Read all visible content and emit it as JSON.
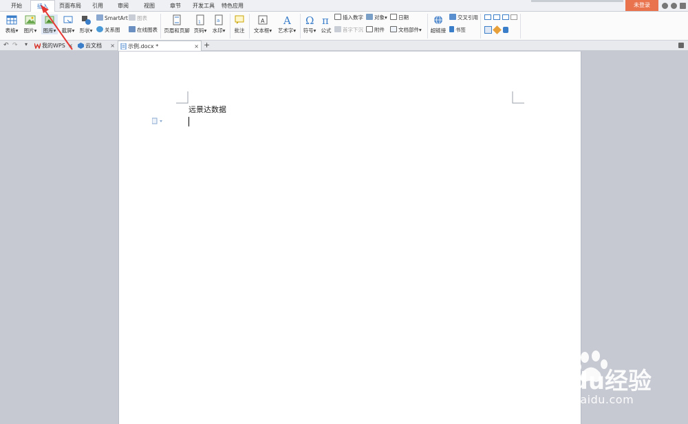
{
  "menu": {
    "tabs": [
      {
        "label": "开始"
      },
      {
        "label": "插入"
      },
      {
        "label": "页面布局"
      },
      {
        "label": "引用"
      },
      {
        "label": "审阅"
      },
      {
        "label": "视图"
      },
      {
        "label": "章节"
      },
      {
        "label": "开发工具"
      },
      {
        "label": "特色应用"
      }
    ],
    "login_label": "未登录"
  },
  "ribbon": {
    "table": "表格",
    "picture": "图片",
    "gallery": "图库",
    "screenshot": "截屏",
    "shape": "形状",
    "smartart": "SmartArt",
    "chart": "图表",
    "relation": "关系图",
    "online_chart": "在线图表",
    "header_footer": "页眉和页脚",
    "page_num": "页码",
    "watermark": "水印",
    "comment": "批注",
    "textbox": "文本框",
    "wordart": "艺术字",
    "symbol": "符号",
    "formula": "公式",
    "insert_number": "插入数字",
    "dropcap": "首字下沉",
    "object": "对象",
    "attachment": "附件",
    "date": "日期",
    "doc_parts": "文档部件",
    "hyperlink": "超链接",
    "cross_ref": "交叉引用",
    "bookmark": "书签"
  },
  "doc_tabs": [
    {
      "label": "我的WPS"
    },
    {
      "label": "云文档"
    },
    {
      "label": "示例.docx *"
    }
  ],
  "document": {
    "text": "远景达数据"
  },
  "watermark": {
    "brand": "Baidu经验",
    "url": "jingyan.baidu.com"
  },
  "colors": {
    "accent": "#2d6fbf",
    "login_bg": "#e9734c",
    "annotation_arrow": "#e53935"
  }
}
